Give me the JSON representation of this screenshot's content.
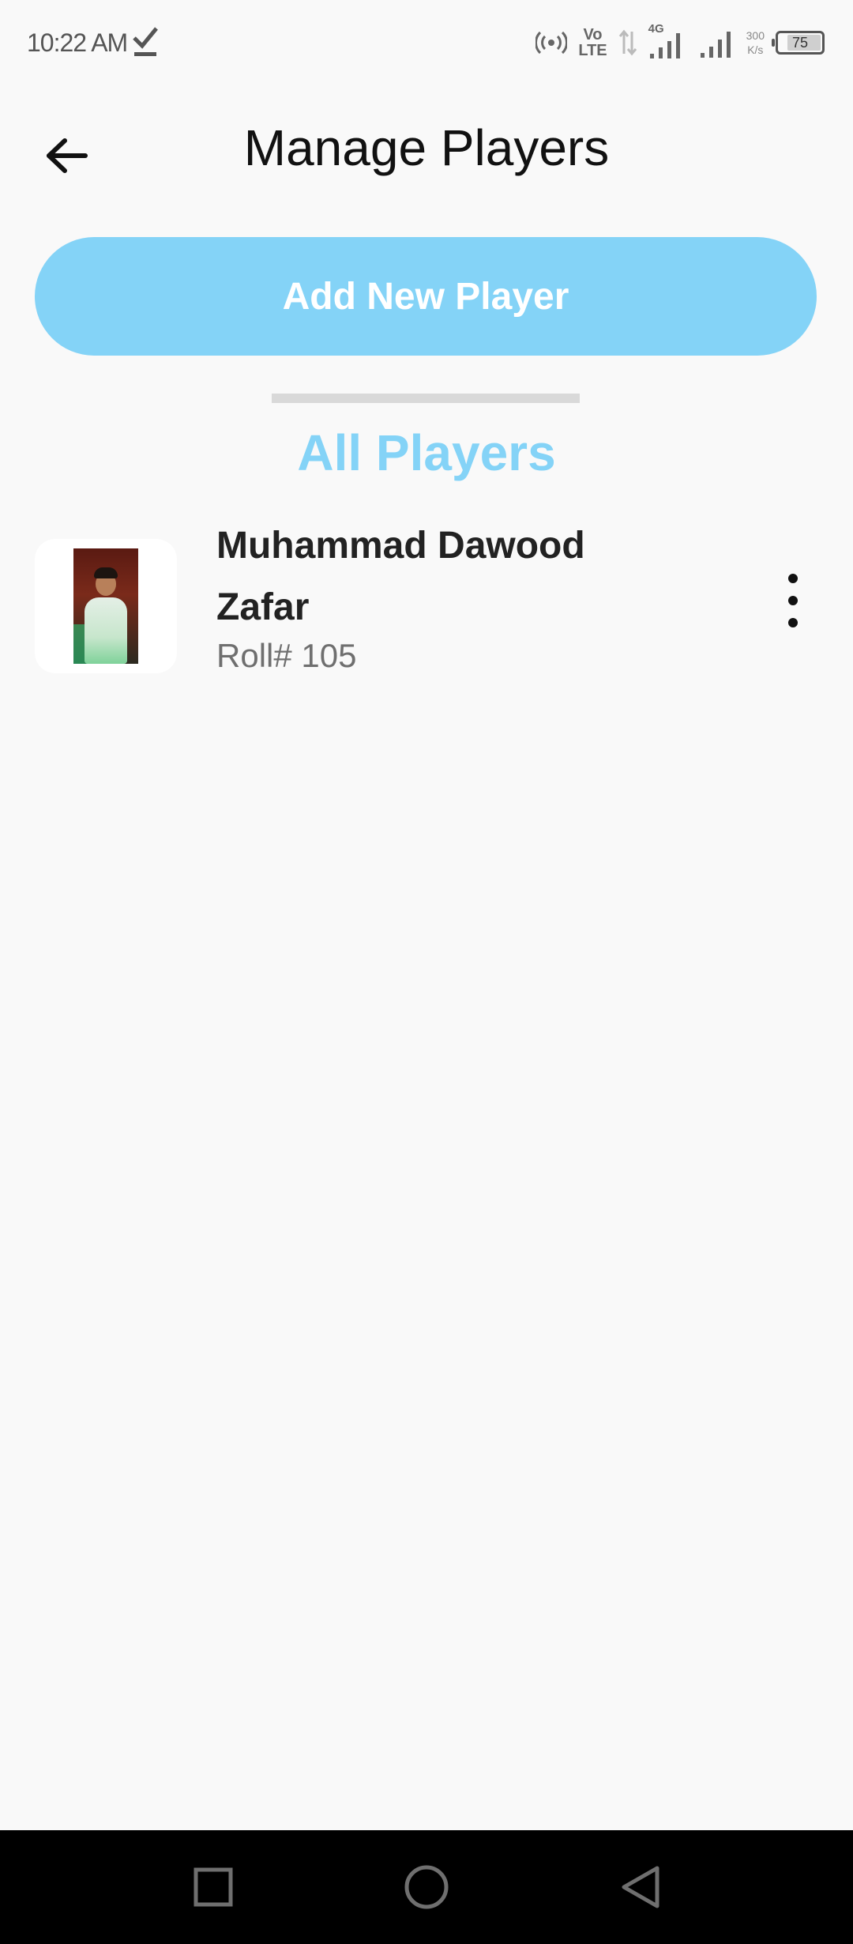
{
  "status_bar": {
    "time": "10:22 AM",
    "network": "4G",
    "volte_top": "Vo",
    "volte_bottom": "LTE",
    "speed_value": "300",
    "speed_unit": "K/s",
    "battery_level": "75"
  },
  "header": {
    "title": "Manage Players",
    "back_icon": "arrow-left-icon"
  },
  "actions": {
    "add_player_label": "Add New Player"
  },
  "section": {
    "title": "All Players"
  },
  "players": [
    {
      "name": "Muhammad Dawood Zafar",
      "roll": "Roll# 105",
      "menu_icon": "more-vertical-icon"
    }
  ],
  "colors": {
    "accent": "#84d3f7",
    "background": "#f9f9f9",
    "nav_bar": "#000000"
  },
  "nav_bar": {
    "icons": [
      "recent-apps-icon",
      "home-icon",
      "back-icon"
    ]
  }
}
